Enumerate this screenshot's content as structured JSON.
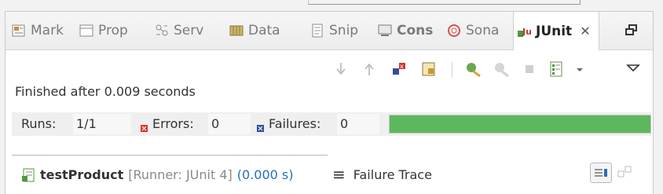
{
  "tabs": [
    {
      "label": "Mark",
      "icon": "markers-icon"
    },
    {
      "label": "Prop",
      "icon": "properties-icon"
    },
    {
      "label": "Serv",
      "icon": "servers-icon"
    },
    {
      "label": "Data",
      "icon": "data-source-icon"
    },
    {
      "label": "Snip",
      "icon": "snippets-icon"
    },
    {
      "label": "Cons",
      "icon": "console-icon"
    },
    {
      "label": "Sona",
      "icon": "sonar-icon"
    },
    {
      "label": "JUnit",
      "icon": "junit-icon",
      "close": "✕"
    }
  ],
  "status": {
    "finished": "Finished after 0.009 seconds"
  },
  "counters": {
    "runs_label": "Runs:",
    "runs_value": "1/1",
    "errors_label": "Errors:",
    "errors_value": "0",
    "failures_label": "Failures:",
    "failures_value": "0",
    "progress_fraction": 1.0,
    "progress_color": "#5cb85c"
  },
  "test": {
    "name": "testProduct",
    "runner": "[Runner: JUnit 4]",
    "time": "(0.000 s)"
  },
  "trace": {
    "label": "Failure Trace"
  },
  "colors": {
    "accent_blue": "#2a6cc2",
    "error_red": "#d9342b",
    "failure_blue": "#2f4f9a"
  }
}
